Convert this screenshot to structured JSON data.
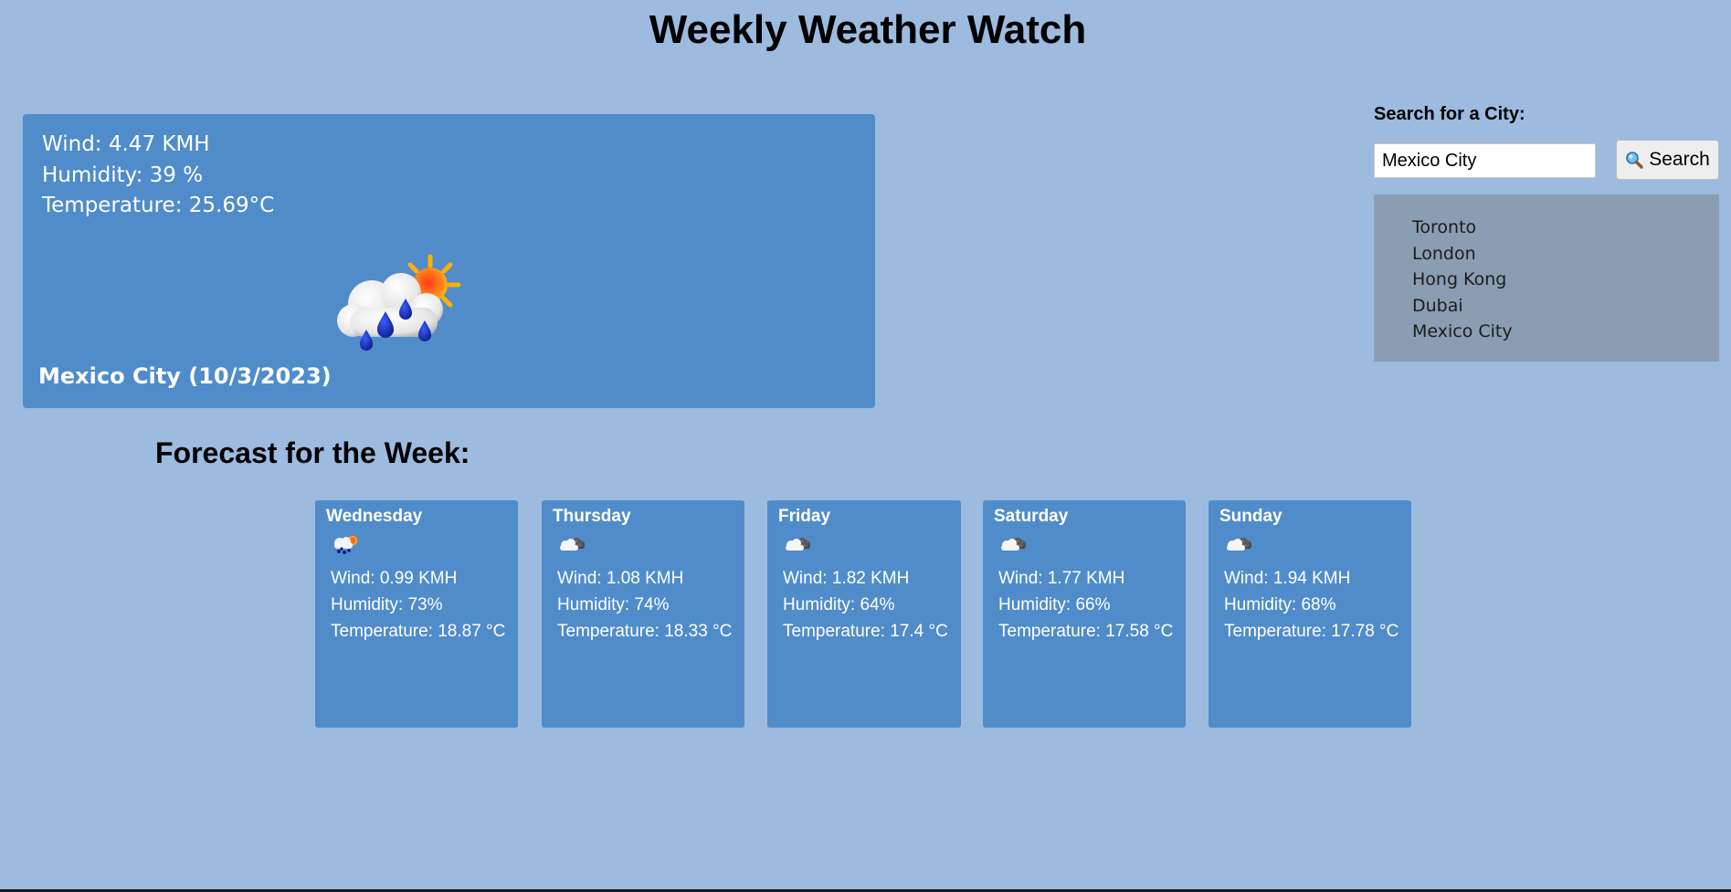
{
  "header": {
    "title": "Weekly Weather Watch"
  },
  "current": {
    "wind_text": "Wind: 4.47 KMH",
    "humidity_text": "Humidity: 39 %",
    "temperature_text": "Temperature: 25.69°C",
    "icon": "rain-sun-cloud-icon",
    "city_date": "Mexico City (10/3/2023)"
  },
  "search": {
    "label": "Search for a City:",
    "input_value": "Mexico City",
    "button_label": "Search",
    "button_icon": "magnifier-icon"
  },
  "history": {
    "items": [
      {
        "label": "Toronto"
      },
      {
        "label": "London"
      },
      {
        "label": "Hong Kong"
      },
      {
        "label": "Dubai"
      },
      {
        "label": "Mexico City"
      }
    ]
  },
  "forecast": {
    "title": "Forecast for the Week:",
    "days": [
      {
        "day": "Wednesday",
        "icon": "rain-sun-cloud-icon",
        "wind": "Wind: 0.99 KMH",
        "humidity": "Humidity: 73%",
        "temperature": "Temperature: 18.87 °C"
      },
      {
        "day": "Thursday",
        "icon": "cloudy-icon",
        "wind": "Wind: 1.08 KMH",
        "humidity": "Humidity: 74%",
        "temperature": "Temperature: 18.33 °C"
      },
      {
        "day": "Friday",
        "icon": "cloudy-icon",
        "wind": "Wind: 1.82 KMH",
        "humidity": "Humidity: 64%",
        "temperature": "Temperature: 17.4 °C"
      },
      {
        "day": "Saturday",
        "icon": "cloudy-icon",
        "wind": "Wind: 1.77 KMH",
        "humidity": "Humidity: 66%",
        "temperature": "Temperature: 17.58 °C"
      },
      {
        "day": "Sunday",
        "icon": "cloudy-icon",
        "wind": "Wind: 1.94 KMH",
        "humidity": "Humidity: 68%",
        "temperature": "Temperature: 17.78 °C"
      }
    ]
  },
  "colors": {
    "page_background": "#9dbadf",
    "card_background": "#508cca",
    "history_background": "#8a9db2"
  }
}
